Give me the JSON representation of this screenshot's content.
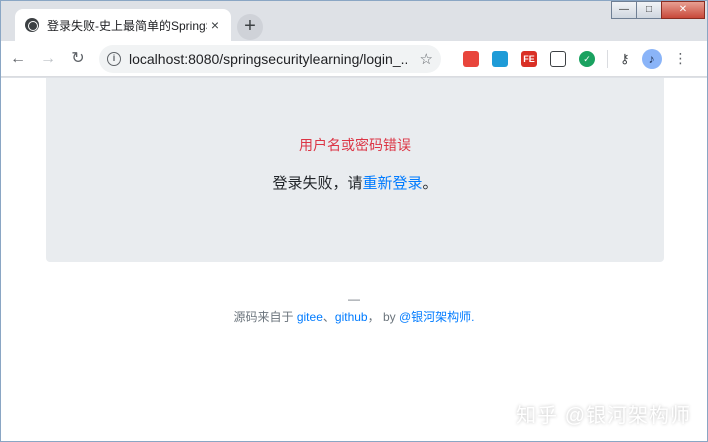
{
  "browser": {
    "tab_title": "登录失败-史上最简单的SpringSe",
    "tab_close": "×",
    "new_tab": "+",
    "window_controls": {
      "minimize": "—",
      "maximize": "□",
      "close": "✕"
    },
    "nav": {
      "back": "←",
      "forward": "→",
      "reload": "↻"
    },
    "url": "localhost:8080/springsecuritylearning/login_...",
    "extensions": [
      "FE"
    ]
  },
  "page": {
    "error_message": "用户名或密码错误",
    "fail_prefix": "登录失败，请",
    "relogin_link": "重新登录",
    "fail_suffix": "。",
    "footer": {
      "dash": "—",
      "source_prefix": "源码来自于",
      "gitee": "gitee",
      "separator": "、",
      "github": "github",
      "comma": "，",
      "by": "by",
      "author": "@银河架构师."
    }
  },
  "watermark": "知乎 @银河架构师",
  "colors": {
    "error": "#dc3545",
    "link": "#007bff",
    "jumbotron": "#e9ecef"
  }
}
